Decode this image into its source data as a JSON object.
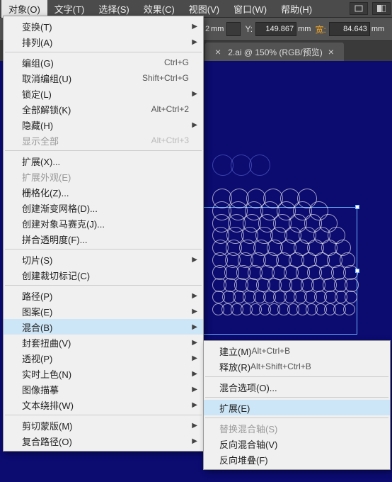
{
  "menubar": {
    "items": [
      "对象(O)",
      "文字(T)",
      "选择(S)",
      "效果(C)",
      "视图(V)",
      "窗口(W)",
      "帮助(H)"
    ]
  },
  "controlbar": {
    "x_unit": "mm",
    "x_suffix": "2",
    "y_label": "Y:",
    "y_value": "149.867",
    "y_unit": "mm",
    "w_label": "宽:",
    "w_value": "84.643",
    "w_unit": "mm"
  },
  "tabs": {
    "items": [
      {
        "title": "2.ai @ 150% (RGB/预览)"
      }
    ]
  },
  "menu": {
    "groups": [
      [
        {
          "label": "变换(T)",
          "arrow": true
        },
        {
          "label": "排列(A)",
          "arrow": true
        }
      ],
      [
        {
          "label": "编组(G)",
          "shortcut": "Ctrl+G"
        },
        {
          "label": "取消编组(U)",
          "shortcut": "Shift+Ctrl+G"
        },
        {
          "label": "锁定(L)",
          "arrow": true
        },
        {
          "label": "全部解锁(K)",
          "shortcut": "Alt+Ctrl+2"
        },
        {
          "label": "隐藏(H)",
          "arrow": true
        },
        {
          "label": "显示全部",
          "shortcut": "Alt+Ctrl+3",
          "disabled": true
        }
      ],
      [
        {
          "label": "扩展(X)..."
        },
        {
          "label": "扩展外观(E)",
          "disabled": true
        },
        {
          "label": "栅格化(Z)..."
        },
        {
          "label": "创建渐变网格(D)..."
        },
        {
          "label": "创建对象马赛克(J)..."
        },
        {
          "label": "拼合透明度(F)..."
        }
      ],
      [
        {
          "label": "切片(S)",
          "arrow": true
        },
        {
          "label": "创建裁切标记(C)"
        }
      ],
      [
        {
          "label": "路径(P)",
          "arrow": true
        },
        {
          "label": "图案(E)",
          "arrow": true
        },
        {
          "label": "混合(B)",
          "arrow": true,
          "highlight": true
        },
        {
          "label": "封套扭曲(V)",
          "arrow": true
        },
        {
          "label": "透视(P)",
          "arrow": true
        },
        {
          "label": "实时上色(N)",
          "arrow": true
        },
        {
          "label": "图像描摹",
          "arrow": true
        },
        {
          "label": "文本绕排(W)",
          "arrow": true
        }
      ],
      [
        {
          "label": "剪切蒙版(M)",
          "arrow": true
        },
        {
          "label": "复合路径(O)",
          "arrow": true
        }
      ]
    ]
  },
  "submenu": {
    "groups": [
      [
        {
          "label": "建立(M)",
          "shortcut": "Alt+Ctrl+B"
        },
        {
          "label": "释放(R)",
          "shortcut": "Alt+Shift+Ctrl+B"
        }
      ],
      [
        {
          "label": "混合选项(O)..."
        }
      ],
      [
        {
          "label": "扩展(E)",
          "highlight": true
        }
      ],
      [
        {
          "label": "替换混合轴(S)",
          "disabled": true
        },
        {
          "label": "反向混合轴(V)"
        },
        {
          "label": "反向堆叠(F)"
        }
      ]
    ]
  }
}
